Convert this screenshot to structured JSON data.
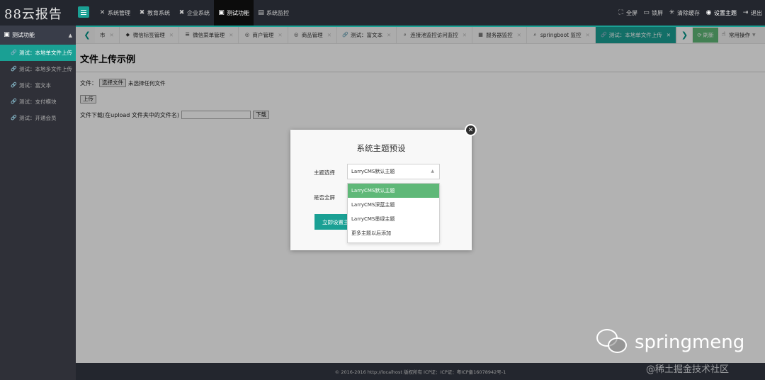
{
  "header": {
    "logo": "88云报告",
    "nav": [
      {
        "icon": "wrench-icon",
        "glyph": "✕",
        "label": "系统管理",
        "active": false
      },
      {
        "icon": "close-icon",
        "glyph": "✖",
        "label": "教育系统",
        "active": false
      },
      {
        "icon": "close-icon",
        "glyph": "✖",
        "label": "企业系统",
        "active": false
      },
      {
        "icon": "terminal-icon",
        "glyph": "▣",
        "label": "测试功能",
        "active": true
      },
      {
        "icon": "monitor-icon",
        "glyph": "▤",
        "label": "系统监控",
        "active": false
      }
    ],
    "right": [
      {
        "icon": "fullscreen-icon",
        "glyph": "⛶",
        "label": "全屏"
      },
      {
        "icon": "screen-lock-icon",
        "glyph": "▭",
        "label": "锁屏"
      },
      {
        "icon": "spinner-icon",
        "glyph": "✳",
        "label": "清除缓存"
      },
      {
        "icon": "palette-icon",
        "glyph": "◉",
        "label": "设置主题",
        "active": true
      },
      {
        "icon": "logout-icon",
        "glyph": "⇥",
        "label": "退出"
      }
    ]
  },
  "sidebar": {
    "header": "测试功能",
    "items": [
      {
        "label": "测试：本地单文件上传",
        "active": true
      },
      {
        "label": "测试：本地多文件上传",
        "active": false
      },
      {
        "label": "测试：富文本",
        "active": false
      },
      {
        "label": "测试：支付模块",
        "active": false
      },
      {
        "label": "测试：开通会员",
        "active": false
      }
    ]
  },
  "tabs": {
    "items": [
      {
        "icon": "",
        "label": "市",
        "active": false
      },
      {
        "icon": "tag-icon",
        "glyph": "◆",
        "label": "微信标签管理",
        "active": false
      },
      {
        "icon": "list-icon",
        "glyph": "☰",
        "label": "微信菜单管理",
        "active": false
      },
      {
        "icon": "circle-icon",
        "glyph": "◎",
        "label": "商户管理",
        "active": false
      },
      {
        "icon": "circle-icon",
        "glyph": "◎",
        "label": "商品管理",
        "active": false
      },
      {
        "icon": "link-icon",
        "glyph": "🔗",
        "label": "测试：富文本",
        "active": false
      },
      {
        "icon": "search-icon",
        "glyph": "⌕",
        "label": "连接池监控访问监控",
        "active": false
      },
      {
        "icon": "server-icon",
        "glyph": "▦",
        "label": "服务器监控",
        "active": false
      },
      {
        "icon": "search-icon",
        "glyph": "⌕",
        "label": "springboot 监控",
        "active": false
      },
      {
        "icon": "link-icon",
        "glyph": "🔗",
        "label": "测试：本地单文件上传",
        "active": true
      }
    ],
    "refresh_label": "刷新",
    "ops_label": "常用操作"
  },
  "main": {
    "title": "文件上传示例",
    "file_label": "文件：",
    "choose_file_button": "选择文件",
    "no_file_text": "未选择任何文件",
    "upload_button": "上传",
    "download_label": "文件下载(在upload 文件夹中的文件名)",
    "download_input_value": "",
    "download_button": "下载"
  },
  "modal": {
    "title": "系统主题预设",
    "theme_label": "主题选择",
    "theme_selected": "LarryCMS默认主题",
    "theme_options": [
      "LarryCMS默认主题",
      "LarryCMS深蓝主题",
      "LarryCMS墨绿主题",
      "更多主题以后添加"
    ],
    "fullscreen_label": "是否全屏",
    "apply_button": "立即设置主题"
  },
  "footer": {
    "text": "© 2016-2016 http://localhost 版权所有 ICP证：ICP证：粤ICP备16078942号-1"
  },
  "watermark": {
    "brand": "springmeng",
    "site": "@稀土掘金技术社区"
  }
}
